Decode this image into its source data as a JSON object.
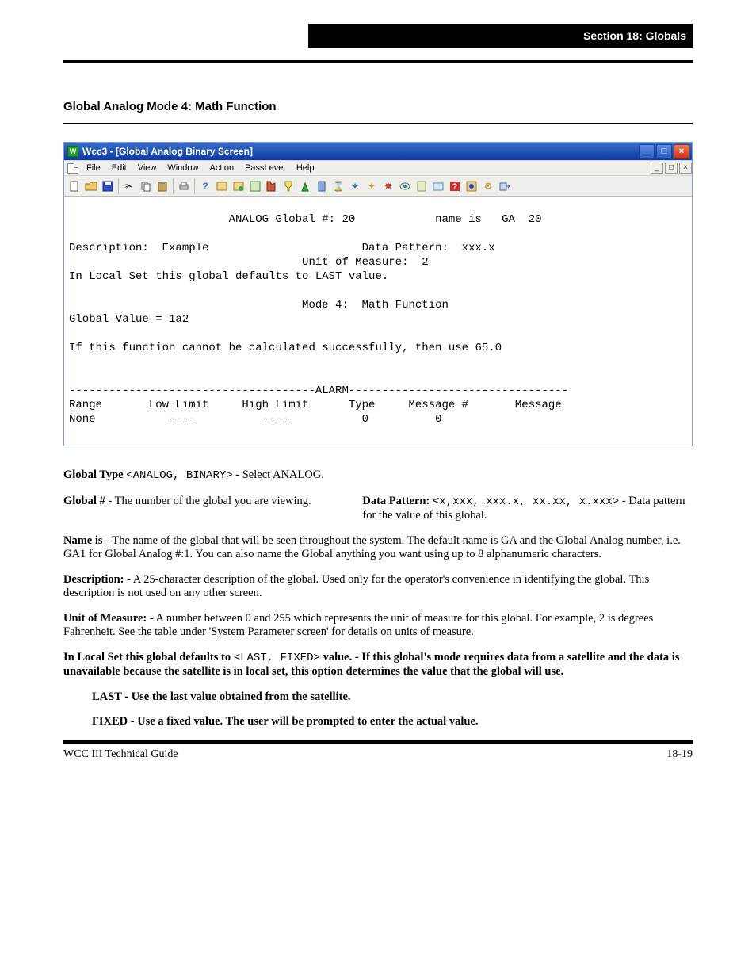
{
  "section_header": "Section 18: Globals",
  "heading_full": "Global Analog Mode 4: Math Function",
  "window": {
    "title": "Wcc3 - [Global Analog Binary Screen]",
    "menu": [
      "File",
      "Edit",
      "View",
      "Window",
      "Action",
      "PassLevel",
      "Help"
    ],
    "toolbar_icons": [
      "new-file-icon",
      "open-folder-icon",
      "save-icon",
      "cut-icon",
      "copy-icon",
      "paste-icon",
      "print-icon",
      "help-q-icon",
      "misc-icon-1",
      "misc-icon-2",
      "misc-icon-3",
      "misc-icon-4",
      "misc-icon-5",
      "misc-icon-6",
      "misc-icon-7",
      "hourglass-icon",
      "wand-icon-1",
      "wand-icon-2",
      "bug-icon",
      "eye-icon",
      "sheet-icon",
      "box-icon",
      "red-q-icon",
      "blue-dot-icon",
      "wrench-icon",
      "exit-icon"
    ]
  },
  "screen": {
    "line1": "                        ANALOG Global #: 20            name is   GA  20",
    "line2": "",
    "line3": "Description:  Example                       Data Pattern:  xxx.x",
    "line4": "                                   Unit of Measure:  2",
    "line5": "In Local Set this global defaults to LAST value.",
    "line6": "",
    "line7": "                                   Mode 4:  Math Function",
    "line8": "Global Value = 1a2",
    "line9": "",
    "line10": "If this function cannot be calculated successfully, then use 65.0",
    "line11": "",
    "line12": "",
    "line13": "-------------------------------------ALARM---------------------------------",
    "line14": "Range       Low Limit     High Limit      Type     Message #       Message",
    "line15": "None           ----          ----           0          0"
  },
  "body": {
    "para1_prefix": "Global Type ",
    "para1_options": "<ANALOG, BINARY>",
    "para1_suffix": " - Select ANALOG.",
    "para2_prefix": "Global # ",
    "para2_suffix": "- The number of the global you are viewing.",
    "para2b_prefix": "Data Pattern: ",
    "para2b_options": "<x,xxx,  xxx.x,  xx.xx,  x.xxx>",
    "para2b_suffix": " - Data pattern for the value of this global.",
    "para3_prefix": "Name is ",
    "para3_suffix": "- The name of the global that will be seen throughout the system. The default name is GA and the Global Analog number, i.e. GA1 for Global Analog #:1. You can also name the Global anything you want using up to 8 alphanumeric characters.",
    "para4_prefix": "Description: ",
    "para4_suffix": "- A 25-character description of the global. Used only for the operator's convenience in identifying the global. This description is not used on any other screen.",
    "para5_prefix": "Unit of Measure: ",
    "para5_suffix": "- A number between 0 and 255 which represents the unit of measure for this global. For example, 2 is degrees Fahrenheit. See the table under 'System Parameter screen' for details on units of measure.",
    "para6a": "In Local Set this global defaults to ",
    "para6_options": "<LAST, FIXED>",
    "para6b": " value. - If this global's mode requires data from a satellite and the data is unavailable because the satellite is in local set, this option determines the value that the global will use.",
    "para6_item1": "LAST - Use the last value obtained from the satellite.",
    "para6_item2": "FIXED - Use a fixed value. The user will be prompted to enter the actual value."
  },
  "footer": {
    "left": "WCC III Technical Guide",
    "right": "18-19"
  }
}
